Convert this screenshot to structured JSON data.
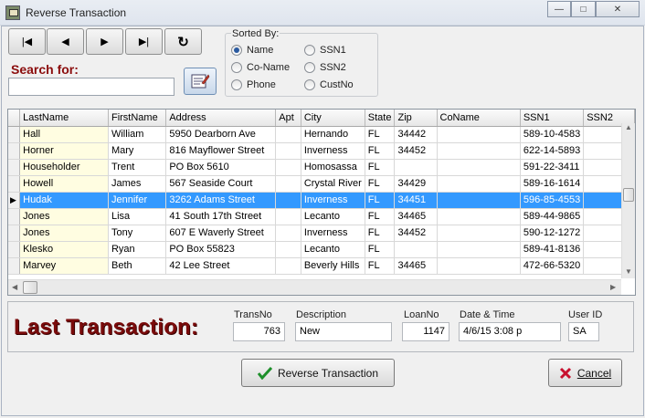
{
  "window": {
    "title": "Reverse Transaction",
    "minimize": "—",
    "maximize": "□",
    "close": "✕"
  },
  "nav": {
    "first": "|◀",
    "prev": "◀",
    "next": "▶",
    "last": "▶|",
    "refresh": "↻"
  },
  "search": {
    "label": "Search for:",
    "value": ""
  },
  "sort": {
    "title": "Sorted By:",
    "options": [
      {
        "label": "Name",
        "selected": true
      },
      {
        "label": "Co-Name",
        "selected": false
      },
      {
        "label": "Phone",
        "selected": false
      },
      {
        "label": "SSN1",
        "selected": false
      },
      {
        "label": "SSN2",
        "selected": false
      },
      {
        "label": "CustNo",
        "selected": false
      }
    ]
  },
  "grid": {
    "columns": [
      "LastName",
      "FirstName",
      "Address",
      "Apt",
      "City",
      "State",
      "Zip",
      "CoName",
      "SSN1",
      "SSN2"
    ],
    "rows": [
      [
        "Hall",
        "William",
        "5950 Dearborn Ave",
        "",
        "Hernando",
        "FL",
        "34442",
        "",
        "589-10-4583",
        ""
      ],
      [
        "Horner",
        "Mary",
        "816 Mayflower Street",
        "",
        "Inverness",
        "FL",
        "34452",
        "",
        "622-14-5893",
        ""
      ],
      [
        "Householder",
        "Trent",
        "PO Box 5610",
        "",
        "Homosassa",
        "FL",
        "",
        "",
        "591-22-3411",
        ""
      ],
      [
        "Howell",
        "James",
        "567 Seaside Court",
        "",
        "Crystal River",
        "FL",
        "34429",
        "",
        "589-16-1614",
        ""
      ],
      [
        "Hudak",
        "Jennifer",
        "3262 Adams Street",
        "",
        "Inverness",
        "FL",
        "34451",
        "",
        "596-85-4553",
        ""
      ],
      [
        "Jones",
        "Lisa",
        "41 South 17th Street",
        "",
        "Lecanto",
        "FL",
        "34465",
        "",
        "589-44-9865",
        ""
      ],
      [
        "Jones",
        "Tony",
        "607 E Waverly Street",
        "",
        "Inverness",
        "FL",
        "34452",
        "",
        "590-12-1272",
        ""
      ],
      [
        "Klesko",
        "Ryan",
        "PO Box 55823",
        "",
        "Lecanto",
        "FL",
        "",
        "",
        "589-41-8136",
        ""
      ],
      [
        "Marvey",
        "Beth",
        "42 Lee Street",
        "",
        "Beverly Hills",
        "FL",
        "34465",
        "",
        "472-66-5320",
        ""
      ]
    ],
    "selected_row": 4
  },
  "last_transaction": {
    "title": "Last Transaction:",
    "transno_label": "TransNo",
    "transno": "763",
    "description_label": "Description",
    "description": "New",
    "loanno_label": "LoanNo",
    "loanno": "1147",
    "datetime_label": "Date & Time",
    "datetime": "4/6/15 3:08 p",
    "userid_label": "User ID",
    "userid": "SA"
  },
  "buttons": {
    "reverse": "Reverse Transaction",
    "cancel": "Cancel"
  },
  "colors": {
    "selection": "#3399ff",
    "title_red": "#7a0b0b",
    "lastname_bg": "#fffde1"
  }
}
